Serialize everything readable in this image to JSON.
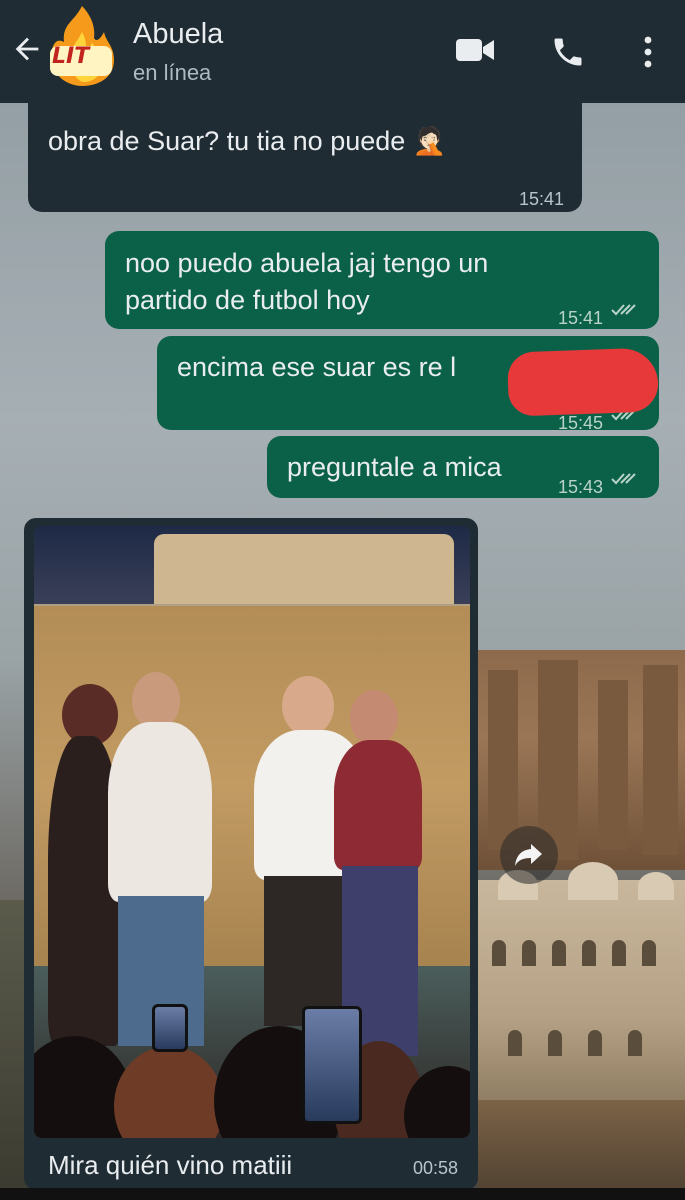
{
  "header": {
    "contact_name": "Abuela",
    "status": "en línea",
    "avatar_badge": "LIT",
    "icons": [
      "back-arrow-icon",
      "video-call-icon",
      "phone-icon",
      "more-vert-icon"
    ]
  },
  "messages": [
    {
      "direction": "in",
      "text": "obra de Suar? tu tia no puede 🤦🏻",
      "time": "15:41"
    },
    {
      "direction": "out",
      "text_line1": "noo puedo abuela jaj tengo un",
      "text_line2": "partido de futbol hoy",
      "time": "15:41"
    },
    {
      "direction": "out",
      "text": "encima ese suar es re l",
      "time": "15:45"
    },
    {
      "direction": "out",
      "text": "preguntale a mica",
      "time": "15:43"
    }
  ],
  "media_message": {
    "caption": "Mira quién vino matiii",
    "time": "00:58"
  },
  "colors": {
    "header_bg": "#1f2c33",
    "incoming_bubble": "#1f2c33",
    "outgoing_bubble": "#0b6148",
    "redaction": "#e8393a"
  }
}
